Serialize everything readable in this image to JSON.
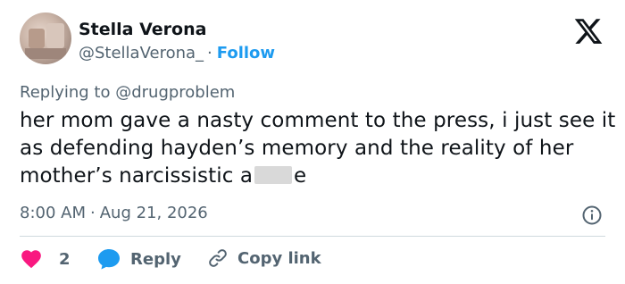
{
  "author": {
    "name": "Stella Verona",
    "handle": "@StellaVerona_",
    "separator": "·",
    "follow_label": "Follow"
  },
  "reply_context": {
    "prefix": "Replying to ",
    "mention": "@drugproblem"
  },
  "tweet": {
    "text_before_censor": "her mom gave a nasty comment to the press, i just see it as defending hayden’s memory and the reality of her mother’s narcissistic a",
    "text_after_censor": "e"
  },
  "meta": {
    "time": "8:00 AM",
    "separator": "·",
    "date": "Aug 21, 2026"
  },
  "actions": {
    "like_count": "2",
    "reply_label": "Reply",
    "copy_label": "Copy link"
  },
  "icons": {
    "brand": "x-logo-icon",
    "info": "info-icon",
    "like": "heart-icon",
    "reply": "speech-bubble-icon",
    "copy": "link-icon"
  },
  "colors": {
    "accent": "#1d9bf0",
    "like": "#f91880",
    "secondary_text": "#536471",
    "primary_text": "#0f1419"
  }
}
